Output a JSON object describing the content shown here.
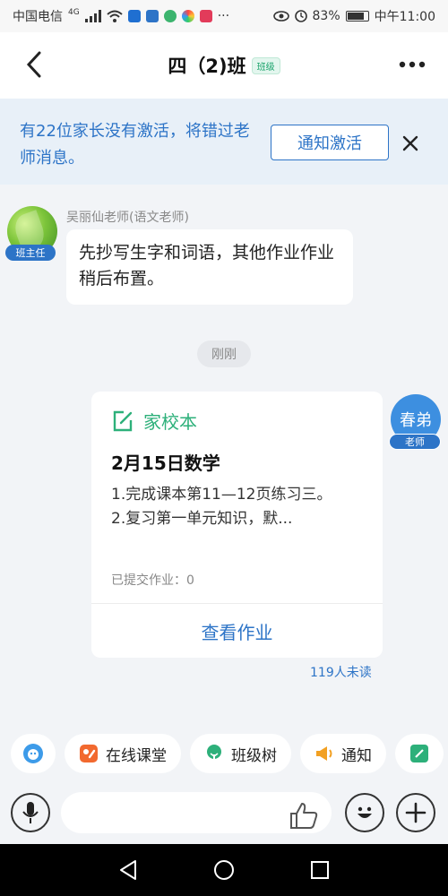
{
  "status_bar": {
    "carrier": "中国电信",
    "network": "4G",
    "battery": "83%",
    "time": "中午11:00"
  },
  "header": {
    "title": "四（2)班",
    "badge": "班级"
  },
  "notice": {
    "text": "有22位家长没有激活，将错过老师消息。",
    "button": "通知激活"
  },
  "message_teacher": {
    "sender": "吴丽仙老师(语文老师)",
    "role": "班主任",
    "text": "先抄写生字和词语，其他作业作业稍后布置。"
  },
  "time_chip": "刚刚",
  "card": {
    "app_name": "家校本",
    "title": "2月15日数学",
    "line1": "1.完成课本第11—12页练习三。",
    "line2": "2.复习第一单元知识，默...",
    "submitted": "已提交作业：0",
    "link": "查看作业"
  },
  "me": {
    "avatar_text": "春弟",
    "role": "老师"
  },
  "unread": "119人未读",
  "quick_bar": {
    "items": [
      "在线课堂",
      "班级树",
      "通知"
    ]
  },
  "colors": {
    "accent_blue": "#2d74c7",
    "green": "#2db07a"
  }
}
